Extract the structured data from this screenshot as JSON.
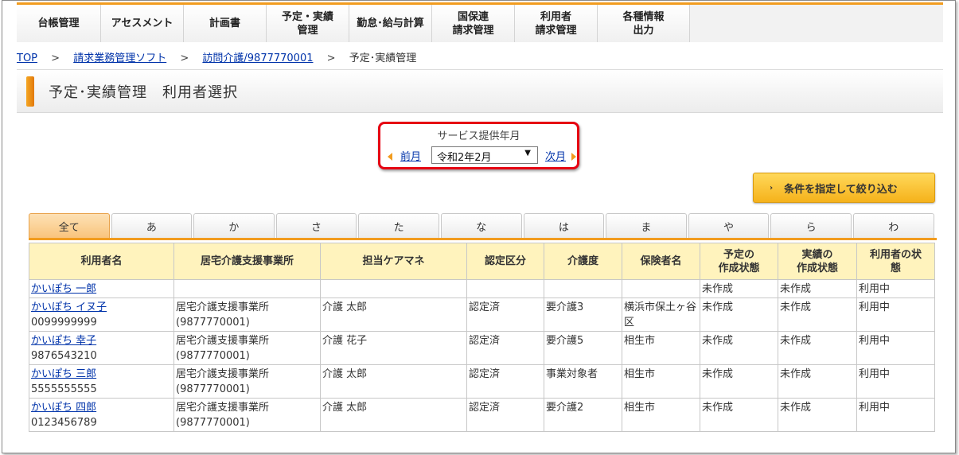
{
  "nav": [
    {
      "label": "台帳管理",
      "w": 106
    },
    {
      "label": "アセスメント",
      "w": 104
    },
    {
      "label": "計画書",
      "w": 104
    },
    {
      "label": "予定・実績\n管理",
      "w": 104
    },
    {
      "label": "勤怠･給与計算",
      "w": 104
    },
    {
      "label": "国保連\n請求管理",
      "w": 104
    },
    {
      "label": "利用者\n請求管理",
      "w": 104
    },
    {
      "label": "各種情報\n出力",
      "w": 116
    }
  ],
  "breadcrumb": {
    "top": "TOP",
    "sep": ">",
    "billing": "請求業務管理ソフト",
    "office": "訪問介護/9877770001",
    "current": "予定･実績管理"
  },
  "page_title": "予定･実績管理　利用者選択",
  "month": {
    "label": "サービス提供年月",
    "prev": "前月",
    "next": "次月",
    "selected": "令和2年2月"
  },
  "filter_button": "条件を指定して絞り込む",
  "tabs": [
    "全て",
    "あ",
    "か",
    "さ",
    "た",
    "な",
    "は",
    "ま",
    "や",
    "ら",
    "わ"
  ],
  "active_tab": 0,
  "table": {
    "headers": [
      "利用者名",
      "居宅介護支援事業所",
      "担当ケアマネ",
      "認定区分",
      "介護度",
      "保険者名",
      "予定の\n作成状態",
      "実績の\n作成状態",
      "利用者の状\n態"
    ],
    "rows": [
      {
        "name": "かいぽち 一郎",
        "id": "",
        "office": "",
        "office_no": "",
        "manager": "",
        "cert": "",
        "care_level": "",
        "insurer": "",
        "plan": "未作成",
        "actual": "未作成",
        "status": "利用中"
      },
      {
        "name": "かいぽち イヌ子",
        "id": "0099999999",
        "office": "居宅介護支援事業所",
        "office_no": "(9877770001)",
        "manager": "介護 太郎",
        "cert": "認定済",
        "care_level": "要介護3",
        "insurer": "横浜市保土ヶ谷区",
        "plan": "未作成",
        "actual": "未作成",
        "status": "利用中"
      },
      {
        "name": "かいぽち 幸子",
        "id": "9876543210",
        "office": "居宅介護支援事業所",
        "office_no": "(9877770001)",
        "manager": "介護 花子",
        "cert": "認定済",
        "care_level": "要介護5",
        "insurer": "相生市",
        "plan": "未作成",
        "actual": "未作成",
        "status": "利用中"
      },
      {
        "name": "かいぽち 三郎",
        "id": "5555555555",
        "office": "居宅介護支援事業所",
        "office_no": "(9877770001)",
        "manager": "介護 太郎",
        "cert": "認定済",
        "care_level": "事業対象者",
        "insurer": "相生市",
        "plan": "未作成",
        "actual": "未作成",
        "status": "利用中"
      },
      {
        "name": "かいぽち 四郎",
        "id": "0123456789",
        "office": "居宅介護支援事業所",
        "office_no": "(9877770001)",
        "manager": "介護 太郎",
        "cert": "認定済",
        "care_level": "要介護2",
        "insurer": "相生市",
        "plan": "未作成",
        "actual": "未作成",
        "status": "利用中"
      }
    ]
  },
  "colors": {
    "accent": "#f29c1f",
    "highlight": "#e60012",
    "header_bg": "#fff3bd",
    "link": "#0033aa"
  }
}
